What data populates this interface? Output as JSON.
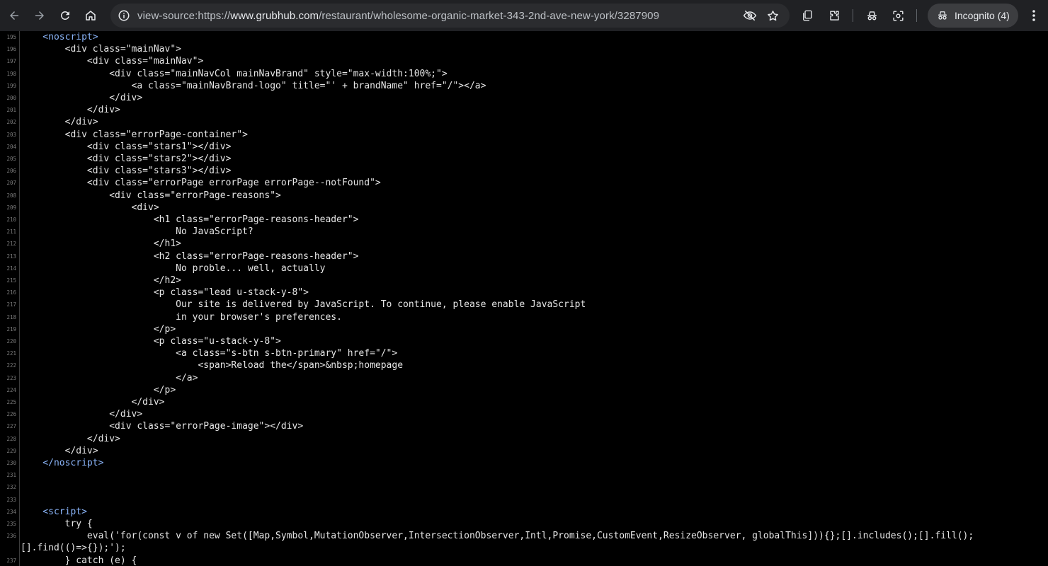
{
  "browser": {
    "url_prefix": "view-source:https://",
    "url_host": "www.grubhub.com",
    "url_path": "/restaurant/wholesome-organic-market-343-2nd-ave-new-york/3287909",
    "incognito_label": "Incognito (4)"
  },
  "icons": {
    "back": "back-arrow-icon",
    "forward": "forward-arrow-icon",
    "reload": "reload-icon",
    "home": "home-icon",
    "site_info": "info-icon",
    "eye_off": "eye-off-icon",
    "bookmark": "star-icon",
    "tab_search": "copy-icon",
    "extensions": "puzzle-icon",
    "devtools": "incognito-icon",
    "lens": "lens-icon",
    "menu": "kebab-menu-icon"
  },
  "colors": {
    "chrome_bg": "#202124",
    "omnibox_bg": "#2b2c2f",
    "source_bg": "#000000",
    "tag_color": "#8ab4f8",
    "text_color": "#e6e6e6"
  },
  "source": {
    "lines": [
      {
        "n": "195",
        "text": "    <noscript>",
        "kind": "tag"
      },
      {
        "n": "196",
        "text": "        <div class=\"mainNav\">"
      },
      {
        "n": "197",
        "text": "            <div class=\"mainNav\">"
      },
      {
        "n": "198",
        "text": "                <div class=\"mainNavCol mainNavBrand\" style=\"max-width:100%;\">"
      },
      {
        "n": "199",
        "text": "                    <a class=\"mainNavBrand-logo\" title=\"' + brandName\" href=\"/\"></a>"
      },
      {
        "n": "200",
        "text": "                </div>"
      },
      {
        "n": "201",
        "text": "            </div>"
      },
      {
        "n": "202",
        "text": "        </div>"
      },
      {
        "n": "203",
        "text": "        <div class=\"errorPage-container\">"
      },
      {
        "n": "204",
        "text": "            <div class=\"stars1\"></div>"
      },
      {
        "n": "205",
        "text": "            <div class=\"stars2\"></div>"
      },
      {
        "n": "206",
        "text": "            <div class=\"stars3\"></div>"
      },
      {
        "n": "207",
        "text": "            <div class=\"errorPage errorPage errorPage--notFound\">"
      },
      {
        "n": "208",
        "text": "                <div class=\"errorPage-reasons\">"
      },
      {
        "n": "209",
        "text": "                    <div>"
      },
      {
        "n": "210",
        "text": "                        <h1 class=\"errorPage-reasons-header\">"
      },
      {
        "n": "211",
        "text": "                            No JavaScript?"
      },
      {
        "n": "212",
        "text": "                        </h1>"
      },
      {
        "n": "213",
        "text": "                        <h2 class=\"errorPage-reasons-header\">"
      },
      {
        "n": "214",
        "text": "                            No proble... well, actually"
      },
      {
        "n": "215",
        "text": "                        </h2>"
      },
      {
        "n": "216",
        "text": "                        <p class=\"lead u-stack-y-8\">"
      },
      {
        "n": "217",
        "text": "                            Our site is delivered by JavaScript. To continue, please enable JavaScript"
      },
      {
        "n": "218",
        "text": "                            in your browser's preferences."
      },
      {
        "n": "219",
        "text": "                        </p>"
      },
      {
        "n": "220",
        "text": "                        <p class=\"u-stack-y-8\">"
      },
      {
        "n": "221",
        "text": "                            <a class=\"s-btn s-btn-primary\" href=\"/\">"
      },
      {
        "n": "222",
        "text": "                                <span>Reload the</span>&nbsp;homepage"
      },
      {
        "n": "223",
        "text": "                            </a>"
      },
      {
        "n": "224",
        "text": "                        </p>"
      },
      {
        "n": "225",
        "text": "                    </div>"
      },
      {
        "n": "226",
        "text": "                </div>"
      },
      {
        "n": "227",
        "text": "                <div class=\"errorPage-image\"></div>"
      },
      {
        "n": "228",
        "text": "            </div>"
      },
      {
        "n": "229",
        "text": "        </div>"
      },
      {
        "n": "230",
        "text": "    </noscript>",
        "kind": "tag"
      },
      {
        "n": "231",
        "text": ""
      },
      {
        "n": "232",
        "text": ""
      },
      {
        "n": "233",
        "text": ""
      },
      {
        "n": "234",
        "text": "    <script>",
        "kind": "tag"
      },
      {
        "n": "235",
        "text": "        try {"
      },
      {
        "n": "236",
        "text": "            eval('for(const v of new Set([Map,Symbol,MutationObserver,IntersectionObserver,Intl,Promise,CustomEvent,ResizeObserver, globalThis])){};[].includes();[].fill();"
      },
      {
        "n": "",
        "text": "[].find(()=>{});');"
      },
      {
        "n": "237",
        "text": "        } catch (e) {"
      }
    ]
  }
}
